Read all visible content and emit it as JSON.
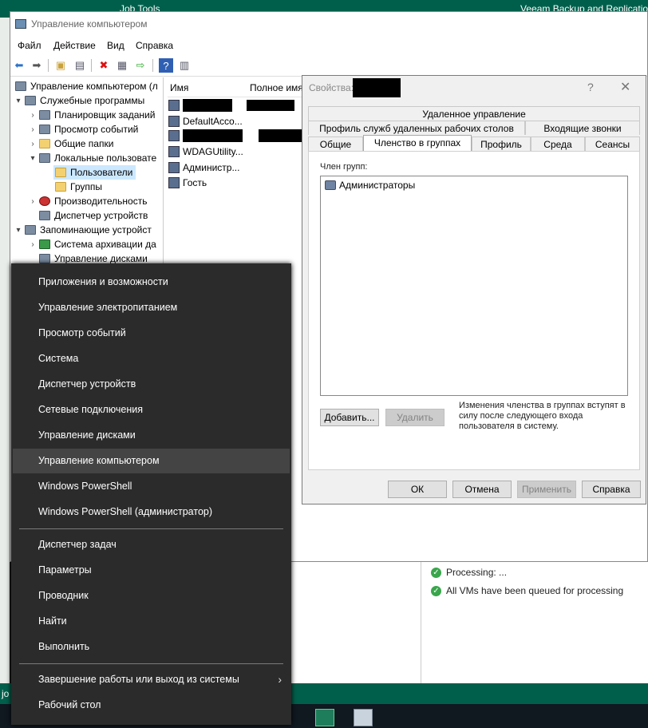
{
  "veeam": {
    "job_tools_label": "Job Tools",
    "app_title": "Veeam Backup and Replication",
    "log": [
      "Processing: ...",
      "All VMs have been queued for processing"
    ],
    "bottom_label": "jo"
  },
  "cm": {
    "title": "Управление компьютером",
    "menu": [
      "Файл",
      "Действие",
      "Вид",
      "Справка"
    ],
    "tree": [
      {
        "label": "Управление компьютером (л",
        "indent": 0
      },
      {
        "label": "Служебные программы",
        "indent": 1
      },
      {
        "label": "Планировщик заданий",
        "indent": 2
      },
      {
        "label": "Просмотр событий",
        "indent": 2
      },
      {
        "label": "Общие папки",
        "indent": 2
      },
      {
        "label": "Локальные пользовате",
        "indent": 2
      },
      {
        "label": "Пользователи",
        "indent": 3
      },
      {
        "label": "Группы",
        "indent": 3
      },
      {
        "label": "Производительность",
        "indent": 2
      },
      {
        "label": "Диспетчер устройств",
        "indent": 2
      },
      {
        "label": "Запоминающие устройст",
        "indent": 1
      },
      {
        "label": "Система архивации да",
        "indent": 2
      },
      {
        "label": "Управление дисками",
        "indent": 2
      }
    ],
    "list_headers": [
      "Имя",
      "Полное имя"
    ],
    "users": [
      "",
      "DefaultAcco...",
      "",
      "WDAGUtility...",
      "Администр...",
      "Гость"
    ]
  },
  "dialog": {
    "title": "Свойства:",
    "help": "?",
    "close": "✕",
    "tabs_row1": [
      "Удаленное управление"
    ],
    "tabs_row2": [
      "Профиль служб удаленных рабочих столов",
      "Входящие звонки"
    ],
    "tabs_row3": [
      "Общие",
      "Членство в группах",
      "Профиль",
      "Среда",
      "Сеансы"
    ],
    "member_of_label": "Член групп:",
    "members": [
      "Администраторы"
    ],
    "add_button": "Добавить...",
    "remove_button": "Удалить",
    "note": "Изменения членства в группах вступят в силу после следующего входа пользователя в систему.",
    "ok": "ОК",
    "cancel": "Отмена",
    "apply": "Применить",
    "help_button": "Справка"
  },
  "winx_menu": {
    "group1": [
      "Приложения и возможности",
      "Управление электропитанием",
      "Просмотр событий",
      "Система",
      "Диспетчер устройств",
      "Сетевые подключения",
      "Управление дисками",
      "Управление компьютером",
      "Windows PowerShell",
      "Windows PowerShell (администратор)"
    ],
    "group2": [
      "Диспетчер задач",
      "Параметры",
      "Проводник",
      "Найти",
      "Выполнить"
    ],
    "group3": [
      "Завершение работы или выход из системы",
      "Рабочий стол"
    ],
    "highlighted": "Управление компьютером"
  }
}
